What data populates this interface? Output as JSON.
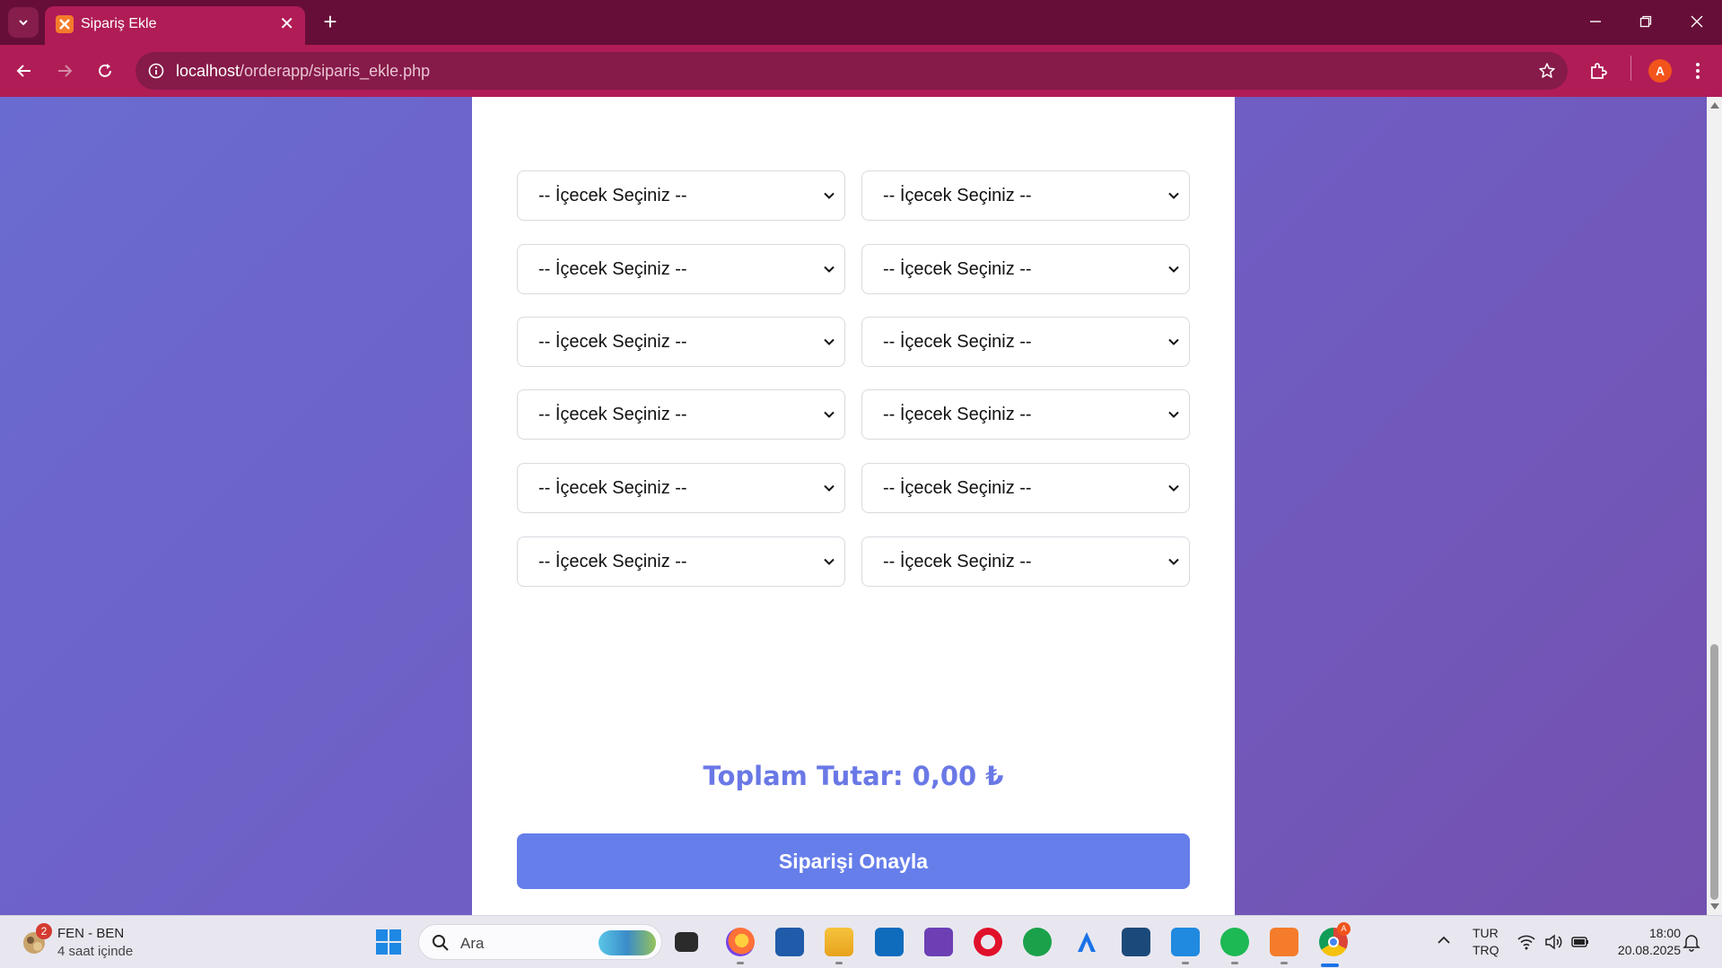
{
  "browser": {
    "tab_title": "Sipariş Ekle",
    "url_host": "localhost",
    "url_path": "/orderapp/siparis_ekle.php",
    "avatar_letter": "A"
  },
  "form": {
    "drink_select_placeholder": "-- İçecek Seçiniz --",
    "total_label": "Toplam Tutar: 0,00 ₺",
    "submit_label": "Siparişi Onayla"
  },
  "taskbar": {
    "weather_badge": "2",
    "weather_title": "FEN - BEN",
    "weather_subtitle": "4 saat içinde",
    "search_placeholder": "Ara",
    "language_top": "TUR",
    "language_bottom": "TRQ",
    "time": "18:00",
    "date": "20.08.2025",
    "chrome_badge": "A"
  },
  "colors": {
    "tabbar": "#660e37",
    "toolbar": "#b01c56",
    "accent": "#667eea",
    "total_text": "#6a78e6"
  }
}
